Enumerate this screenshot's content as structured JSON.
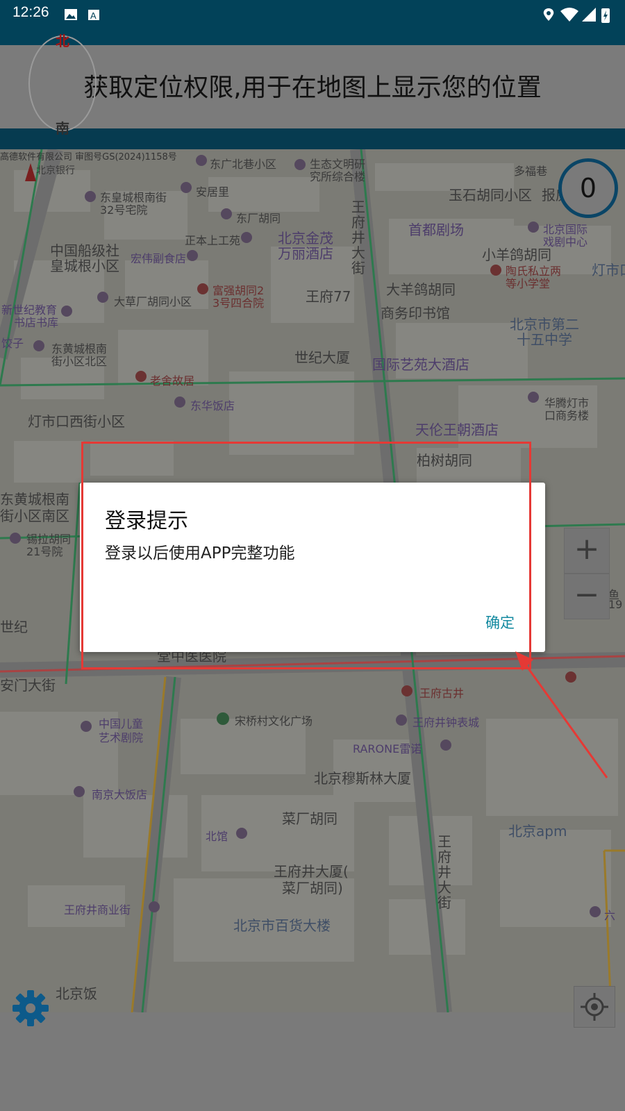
{
  "status_bar": {
    "time": "12:26",
    "icons": [
      "image-icon",
      "a-text-icon",
      "location-pin-icon",
      "wifi-icon",
      "signal-icon",
      "battery-charging-icon"
    ]
  },
  "banner": {
    "text": "获取定位权限,用于在地图上显示您的位置"
  },
  "map": {
    "copyright": "高德软件有限公司 审图号GS(2024)1158号",
    "compass": {
      "north": "北",
      "south": "南"
    },
    "counter": "0",
    "zoom_in": "+",
    "zoom_out": "−",
    "labels": [
      {
        "text": "北京银行"
      },
      {
        "text": "东广北巷小区"
      },
      {
        "text": "生态文明研"
      },
      {
        "text": "究所综合楼"
      },
      {
        "text": "多福巷"
      },
      {
        "text": "东皇城根南街"
      },
      {
        "text": "32号宅院"
      },
      {
        "text": "安居里"
      },
      {
        "text": "东厂胡同"
      },
      {
        "text": "玉石胡同小区"
      },
      {
        "text": "报房"
      },
      {
        "text": "正本上工苑"
      },
      {
        "text": "北京金茂"
      },
      {
        "text": "万丽酒店"
      },
      {
        "text": "王府井大街"
      },
      {
        "text": "首都剧场"
      },
      {
        "text": "北京国际"
      },
      {
        "text": "戏剧中心"
      },
      {
        "text": "中国船级社"
      },
      {
        "text": "皇城根小区"
      },
      {
        "text": "宏伟副食店"
      },
      {
        "text": "小羊鸽胡同"
      },
      {
        "text": "陶氏私立两"
      },
      {
        "text": "等小学堂"
      },
      {
        "text": "灯市口"
      },
      {
        "text": "富强胡同2"
      },
      {
        "text": "3号四合院"
      },
      {
        "text": "王府77"
      },
      {
        "text": "大羊鸽胡同"
      },
      {
        "text": "大草厂胡同小区"
      },
      {
        "text": "商务印书馆"
      },
      {
        "text": "新世纪教育"
      },
      {
        "text": "书店书库"
      },
      {
        "text": "北京市第二"
      },
      {
        "text": "十五中学"
      },
      {
        "text": "饺子"
      },
      {
        "text": "东黄城根南"
      },
      {
        "text": "街小区北区"
      },
      {
        "text": "世纪大厦"
      },
      {
        "text": "国际艺苑大酒店"
      },
      {
        "text": "老舍故居"
      },
      {
        "text": "华腾灯市"
      },
      {
        "text": "口商务楼"
      },
      {
        "text": "东华饭店"
      },
      {
        "text": "灯市口西街小区"
      },
      {
        "text": "天伦王朝酒店"
      },
      {
        "text": "柏树胡同"
      },
      {
        "text": "东黄城根南"
      },
      {
        "text": "街小区南区"
      },
      {
        "text": "锡拉胡同"
      },
      {
        "text": "21号院"
      },
      {
        "text": "金鱼"
      },
      {
        "text": "19"
      },
      {
        "text": "世纪"
      },
      {
        "text": "堂中医医院"
      },
      {
        "text": "安门大街"
      },
      {
        "text": "王府古井"
      },
      {
        "text": "中国儿童"
      },
      {
        "text": "艺术剧院"
      },
      {
        "text": "宋桥村文化广场"
      },
      {
        "text": "王府井钟表城"
      },
      {
        "text": "RARONE雷诺"
      },
      {
        "text": "北京穆斯林大厦"
      },
      {
        "text": "南京大饭店"
      },
      {
        "text": "菜厂胡同"
      },
      {
        "text": "北京apm"
      },
      {
        "text": "北馆"
      },
      {
        "text": "王府井大厦("
      },
      {
        "text": "菜厂胡同)"
      },
      {
        "text": "王府井大街"
      },
      {
        "text": "王府井商业街"
      },
      {
        "text": "六"
      },
      {
        "text": "北京市百货大楼"
      },
      {
        "text": "北京饭"
      }
    ]
  },
  "dialog": {
    "title": "登录提示",
    "message": "登录以后使用APP完整功能",
    "ok_label": "确定"
  },
  "colors": {
    "status_bar": "#024259",
    "accent_button": "#148aa0",
    "highlight_box": "#e53935",
    "counter_ring": "#0a4566"
  }
}
